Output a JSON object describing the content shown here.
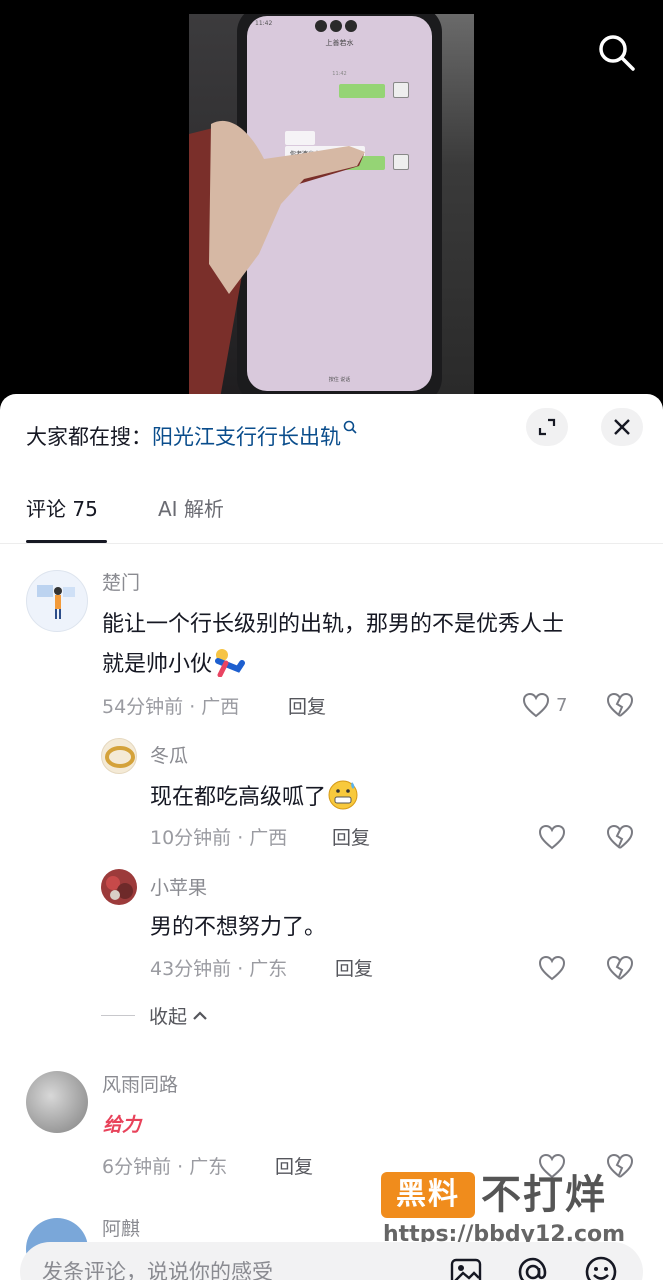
{
  "video": {
    "phone_chat_title": "上善若水",
    "phone_message": "你老婆出去啊，睡电视。",
    "phone_input_hint": "按住 说话"
  },
  "search_suggest": {
    "prefix": "大家都在搜：",
    "query": "阳光江支行行长出轨"
  },
  "tabs": [
    {
      "label": "评论 75",
      "active": true
    },
    {
      "label": "AI 解析",
      "active": false
    }
  ],
  "comments": {
    "c1": {
      "user": "楚门",
      "text_line1": "能让一个行长级别的出轨，那男的不是优秀人士",
      "text_line2": "就是帅小伙",
      "meta": "54分钟前 · 广西",
      "reply_label": "回复",
      "like_count": "7"
    },
    "r1": {
      "user": "冬瓜",
      "text": "现在都吃高级呱了",
      "meta": "10分钟前 · 广西",
      "reply_label": "回复"
    },
    "r2": {
      "user": "小苹果",
      "text": "男的不想努力了。",
      "meta": "43分钟前 · 广东",
      "reply_label": "回复"
    },
    "collapse_label": "收起",
    "c2": {
      "user": "风雨同路",
      "sticker_text": "给力",
      "meta": "6分钟前 · 广东",
      "reply_label": "回复"
    },
    "c3": {
      "user": "阿麒"
    }
  },
  "watermark": {
    "badge": "黑料",
    "text": "不打烊",
    "url": "https://bbdy12.com"
  },
  "input": {
    "placeholder": "发条评论，说说你的感受"
  },
  "colors": {
    "accent_link": "#0a4d8c",
    "watermark_orange": "#f08c1c",
    "sticker_red": "#e8425a"
  }
}
